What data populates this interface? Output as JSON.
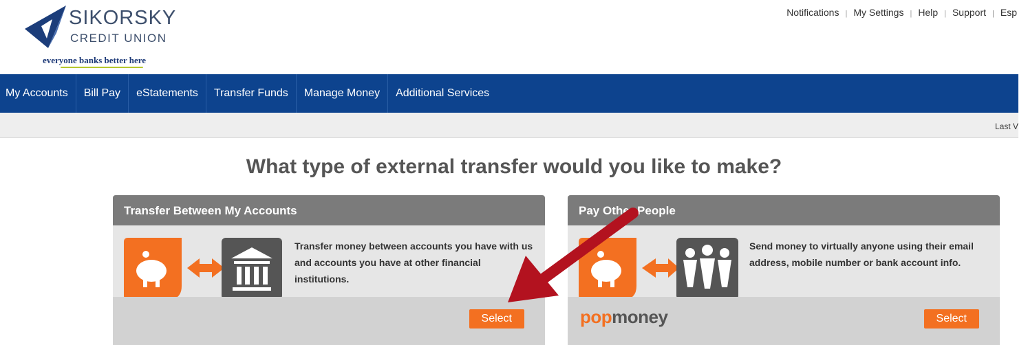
{
  "logo": {
    "name": "SIKORSKY",
    "sub": "CREDIT UNION",
    "tagline": "everyone banks better here"
  },
  "toplinks": [
    "Notifications",
    "My Settings",
    "Help",
    "Support",
    "Esp"
  ],
  "nav": [
    "My Accounts",
    "Bill Pay",
    "eStatements",
    "Transfer Funds",
    "Manage Money",
    "Additional Services"
  ],
  "subbar": {
    "last_visit": "Last V"
  },
  "heading": "What type of external transfer would you like to make?",
  "cards": [
    {
      "title": "Transfer Between My Accounts",
      "description": "Transfer money between accounts you have with us and accounts you have at other financial institutions.",
      "button": "Select"
    },
    {
      "title": "Pay Other People",
      "description": "Send money to virtually anyone using their email address, mobile number or bank account info.",
      "button": "Select",
      "brand_pop": "pop",
      "brand_money": "money"
    }
  ],
  "colors": {
    "nav_bg": "#0d438e",
    "accent": "#f37021",
    "card_header": "#7b7b7b",
    "arrow": "#b3121f"
  }
}
